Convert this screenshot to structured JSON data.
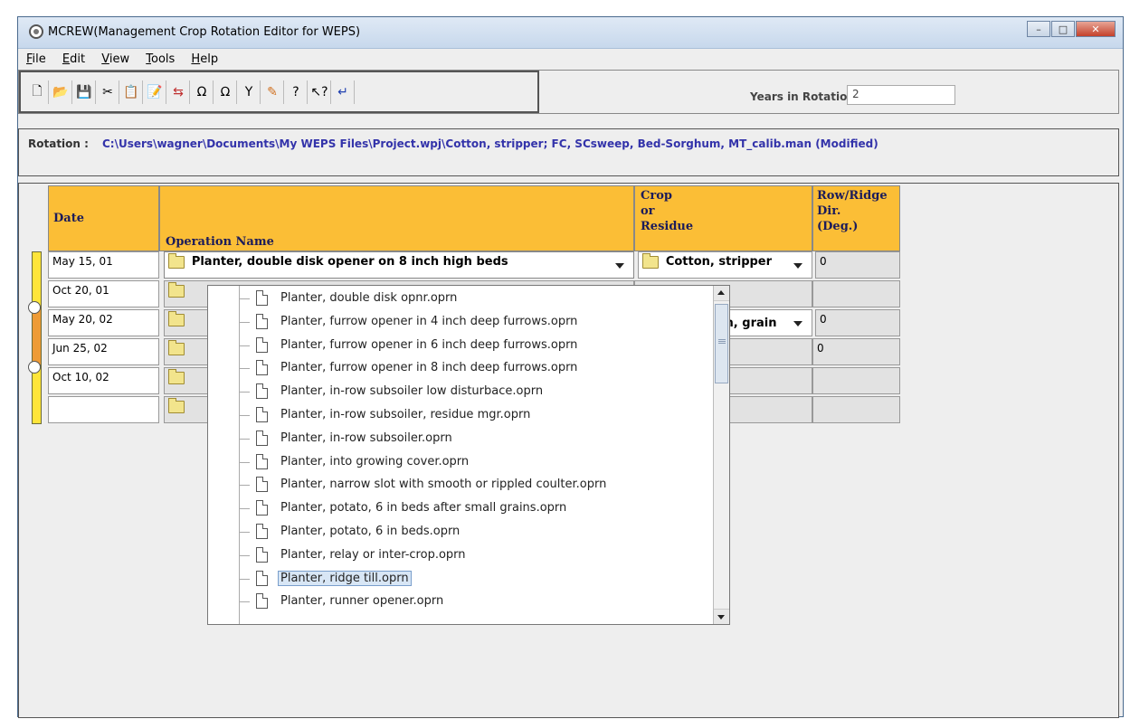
{
  "window": {
    "title": "MCREW(Management Crop Rotation Editor for WEPS)"
  },
  "menu": [
    "File",
    "Edit",
    "View",
    "Tools",
    "Help"
  ],
  "toolbar": {
    "buttons": [
      "new-icon",
      "open-icon",
      "save-icon",
      "cut-icon",
      "copy-icon",
      "paste-icon",
      "replace-icon",
      "undo-icon",
      "redo-icon",
      "filter-icon",
      "pencil-icon",
      "help-icon",
      "context-help-icon",
      "return-icon"
    ],
    "years_label": "Years in Rotation:",
    "years_value": "2"
  },
  "rotation": {
    "label": "Rotation :",
    "path": "C:\\Users\\wagner\\Documents\\My WEPS Files\\Project.wpj\\Cotton, stripper; FC, SCsweep, Bed-Sorghum, MT_calib.man  (Modified)"
  },
  "table": {
    "headers": {
      "date": "Date",
      "operation": "Operation Name",
      "crop_l1": "Crop",
      "crop_l2": "or",
      "crop_l3": "Residue",
      "dir_l1": "Row/Ridge",
      "dir_l2": "Dir.",
      "dir_l3": "(Deg.)"
    },
    "rows": [
      {
        "date": "May 15, 01",
        "operation": "Planter, double disk opener on 8 inch high beds",
        "crop": "Cotton, stripper",
        "dir": "0"
      },
      {
        "date": "Oct 20, 01",
        "operation": "",
        "crop": "",
        "dir": ""
      },
      {
        "date": "May 20, 02",
        "operation": "",
        "crop": "um, grain",
        "dir": "0"
      },
      {
        "date": "Jun 25, 02",
        "operation": "",
        "crop": "",
        "dir": "0"
      },
      {
        "date": "Oct 10, 02",
        "operation": "",
        "crop": "",
        "dir": ""
      },
      {
        "date": "",
        "operation": "",
        "crop": "",
        "dir": ""
      }
    ]
  },
  "popup": {
    "items": [
      "Planter, double disk opnr.oprn",
      "Planter, furrow opener in 4 inch deep furrows.oprn",
      "Planter, furrow opener in 6 inch deep furrows.oprn",
      "Planter, furrow opener in 8 inch deep furrows.oprn",
      "Planter, in-row subsoiler low disturbace.oprn",
      "Planter, in-row subsoiler, residue mgr.oprn",
      "Planter, in-row subsoiler.oprn",
      "Planter, into growing cover.oprn",
      "Planter, narrow slot with smooth or rippled coulter.oprn",
      "Planter, potato, 6 in beds after small grains.oprn",
      "Planter, potato, 6 in beds.oprn",
      "Planter, relay or inter-crop.oprn",
      "Planter, ridge till.oprn",
      "Planter, runner opener.oprn"
    ],
    "selected": "Planter, ridge till.oprn"
  },
  "colors": {
    "header_bg": "#fbbe36",
    "path_text": "#3333aa",
    "selection_bg": "#d8e6f5"
  }
}
